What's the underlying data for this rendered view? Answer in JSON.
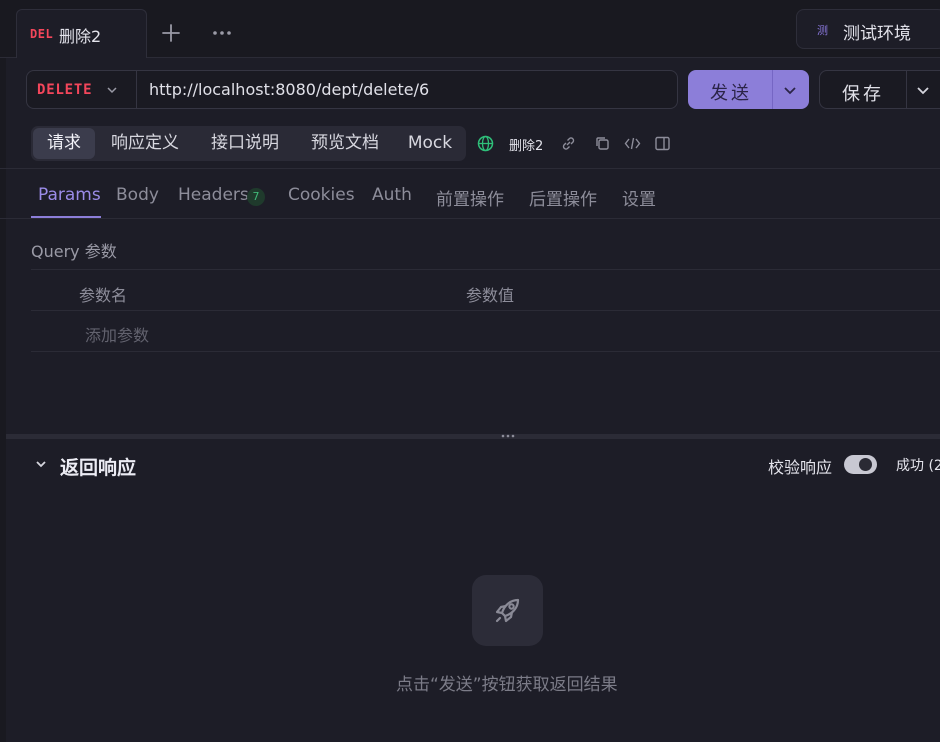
{
  "tab": {
    "method": "DEL",
    "title": "删除2"
  },
  "env": {
    "icon_text": "测",
    "label": "测试环境"
  },
  "request": {
    "method": "DELETE",
    "url": "http://localhost:8080/dept/delete/6",
    "send_label": "发送",
    "save_label": "保存"
  },
  "segments": [
    "请求",
    "响应定义",
    "接口说明",
    "预览文档",
    "Mock"
  ],
  "toolbar": {
    "name": "删除2"
  },
  "subtabs": {
    "params": "Params",
    "body": "Body",
    "headers": "Headers",
    "headers_count": "7",
    "cookies": "Cookies",
    "auth": "Auth",
    "pre": "前置操作",
    "post": "后置操作",
    "settings": "设置"
  },
  "query": {
    "title": "Query 参数",
    "col_name": "参数名",
    "col_value": "参数值",
    "add_placeholder": "添加参数"
  },
  "response": {
    "title": "返回响应",
    "validate_label": "校验响应",
    "status_text": "成功 (2",
    "empty_hint": "点击“发送”按钮获取返回结果"
  },
  "colors": {
    "accent": "#8c7ed9",
    "method_delete": "#f4465b",
    "badge_green": "#40b878"
  },
  "icons": [
    "plus-icon",
    "more-icon",
    "chevron-down-icon",
    "globe-icon",
    "link-icon",
    "copy-icon",
    "code-icon",
    "sidebar-icon",
    "rocket-icon",
    "grip-icon"
  ]
}
